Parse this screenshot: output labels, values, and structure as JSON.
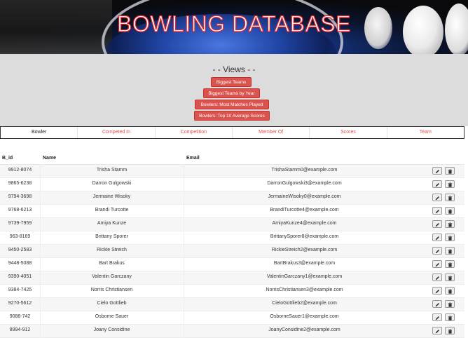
{
  "header": {
    "title": "BOWLING DATABASE"
  },
  "views": {
    "title": "- - Views - -",
    "buttons": [
      "Biggest Teams",
      "Biggest Teams by Year",
      "Bowlers: Most Matches Played",
      "Bowlers: Top 10 Average Scores"
    ]
  },
  "tabs": [
    "Bowler",
    "Competed In",
    "Competition",
    "Member Of",
    "Scores",
    "Team"
  ],
  "active_tab": "Bowler",
  "table": {
    "headers": [
      "B_id",
      "Name",
      "Email"
    ],
    "rows": [
      {
        "id": "9912-8074",
        "name": "Trisha Stamm",
        "email": "TrishaStamm0@example.com"
      },
      {
        "id": "9865-6238",
        "name": "Darron Gulgowski",
        "email": "DarronGulgowski3@example.com"
      },
      {
        "id": "9794-3698",
        "name": "Jermaine Wisoky",
        "email": "JermaineWisoky0@example.com"
      },
      {
        "id": "9768-6213",
        "name": "Brandi Turcotte",
        "email": "BrandiTurcotte4@example.com"
      },
      {
        "id": "9739-7959",
        "name": "Amiya Kunze",
        "email": "AmiyaKunze4@example.com"
      },
      {
        "id": "963-8169",
        "name": "Brittany Sporer",
        "email": "BrittanySporer8@example.com"
      },
      {
        "id": "9450-2583",
        "name": "Rickie Streich",
        "email": "RickieStreich2@example.com"
      },
      {
        "id": "9448-5088",
        "name": "Bart Brakus",
        "email": "BartBrakus3@example.com"
      },
      {
        "id": "9390-4051",
        "name": "Valentin Garczany",
        "email": "ValentinGarczany1@example.com"
      },
      {
        "id": "9384-7425",
        "name": "Norris Christiansen",
        "email": "NorrisChristiansen3@example.com"
      },
      {
        "id": "9270-5612",
        "name": "Cielo Gottlieb",
        "email": "CieloGottlieb2@example.com"
      },
      {
        "id": "9088-742",
        "name": "Osborne Sauer",
        "email": "OsborneSauer1@example.com"
      },
      {
        "id": "8994-912",
        "name": "Joany Considine",
        "email": "JoanyConsidine2@example.com"
      }
    ]
  },
  "colors": {
    "accent": "#d9534f",
    "views_bg": "#dcdcdc"
  },
  "icons": {
    "edit": "pencil-icon",
    "delete": "trash-icon"
  }
}
